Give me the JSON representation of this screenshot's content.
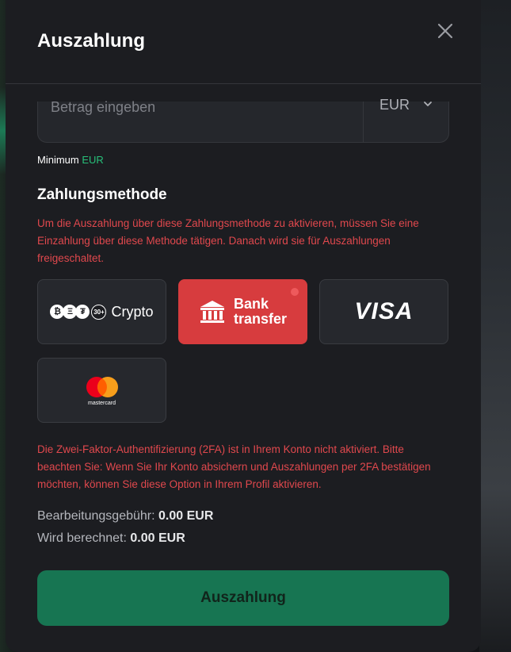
{
  "modal": {
    "title": "Auszahlung"
  },
  "amount": {
    "placeholder": "Betrag eingeben",
    "currency": "EUR"
  },
  "minimum": {
    "label": "Minimum",
    "currency": "EUR"
  },
  "payment": {
    "title": "Zahlungsmethode",
    "warning": "Um die Auszahlung über diese Zahlungsmethode zu aktivieren, müssen Sie eine Einzahlung über diese Methode tätigen. Danach wird sie für Auszahlungen freigeschaltet.",
    "methods": {
      "crypto": {
        "label": "Crypto",
        "more_badge": "30+",
        "coins": [
          "₿",
          "Ξ",
          "₮"
        ]
      },
      "bank": {
        "line1": "Bank",
        "line2": "transfer",
        "selected": true
      },
      "visa": {
        "label": "VISA"
      },
      "mastercard": {
        "label": "mastercard"
      }
    }
  },
  "twofa_warning": "Die Zwei-Faktor-Authentifizierung (2FA) ist in Ihrem Konto nicht aktiviert. Bitte beachten Sie: Wenn Sie Ihr Konto absichern und Auszahlungen per 2FA bestätigen möchten, können Sie diese Option in Ihrem Profil aktivieren.",
  "summary": {
    "fee_label": "Bearbeitungsgebühr:",
    "fee_value": "0.00 EUR",
    "charged_label": "Wird berechnet:",
    "charged_value": "0.00 EUR"
  },
  "submit_label": "Auszahlung",
  "colors": {
    "accent_green": "#177552",
    "selected_red": "#d73c3e",
    "warning_red": "#e0484d",
    "min_green": "#27c07a"
  }
}
